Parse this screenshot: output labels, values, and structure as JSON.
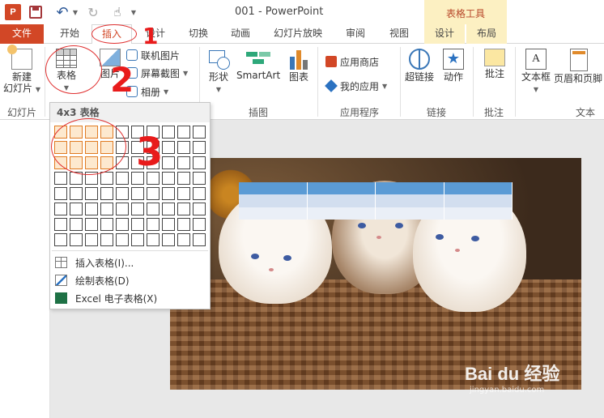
{
  "titlebar": {
    "app_icon": "P",
    "title": "001 - PowerPoint",
    "contextual_group": "表格工具",
    "icons": [
      "powerpoint-logo-icon",
      "save-icon",
      "undo-icon",
      "redo-icon",
      "touch-mode-icon"
    ]
  },
  "tabs": {
    "file": "文件",
    "home": "开始",
    "insert": "插入",
    "design": "设计",
    "transitions": "切换",
    "animations": "动画",
    "slideshow": "幻灯片放映",
    "review": "审阅",
    "view": "视图",
    "table_design": "设计",
    "table_layout": "布局"
  },
  "ribbon": {
    "new_slide": [
      "新建",
      "幻灯片"
    ],
    "table": "表格",
    "pictures": "图片",
    "online_pictures": "联机图片",
    "screenshot": "屏幕截图",
    "album": "相册",
    "shapes": "形状",
    "smartart": "SmartArt",
    "chart": "图表",
    "store": "应用商店",
    "my_apps": "我的应用",
    "hyperlink": "超链接",
    "action": "动作",
    "comment": "批注",
    "textbox": "文本框",
    "header_footer": "页眉和页脚",
    "groups": {
      "slides": "幻灯片",
      "illustrations": "插图",
      "apps": "应用程序",
      "links": "链接",
      "comments": "批注",
      "text": "文本"
    }
  },
  "table_menu": {
    "header": "4x3 表格",
    "grid_cols": 10,
    "grid_rows": 8,
    "highlight_cols": 4,
    "highlight_rows": 3,
    "items": [
      "插入表格(I)...",
      "绘制表格(D)",
      "Excel 电子表格(X)"
    ]
  },
  "annotations": [
    "1",
    "2",
    "3"
  ],
  "watermark": {
    "brand": "Bai du 经验",
    "url": "jingyan.baidu.com"
  },
  "colors": {
    "accent": "#d24726",
    "tools_band": "#fcf0c2",
    "highlight_cell": "#e07b22",
    "annotation": "#e03030",
    "table_header": "#5b9bd5"
  }
}
